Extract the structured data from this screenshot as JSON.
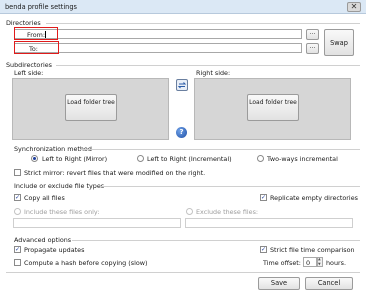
{
  "window": {
    "title": "benda profile settings",
    "close_glyph": "✕"
  },
  "directories": {
    "section_label": "Directories",
    "from_label": "From:",
    "from_value": "",
    "to_label": "To:",
    "to_value": "",
    "browse_label": "...",
    "swap_label": "Swap"
  },
  "subdirectories": {
    "section_label": "Subdirectories",
    "left_label": "Left side:",
    "right_label": "Right side:",
    "load_left_label": "Load folder tree",
    "load_right_label": "Load folder tree",
    "help_glyph": "?"
  },
  "sync": {
    "section_label": "Synchronization method",
    "options": [
      {
        "label": "Left to Right (Mirror)",
        "selected": true
      },
      {
        "label": "Left to Right (Incremental)",
        "selected": false
      },
      {
        "label": "Two-ways incremental",
        "selected": false
      }
    ],
    "strict_mirror_label": "Strict mirror: revert files that were modified on the right.",
    "strict_mirror_checked": false
  },
  "filters": {
    "section_label": "Include or exclude file types",
    "copy_all_label": "Copy all files",
    "copy_all_checked": true,
    "replicate_label": "Replicate empty directories",
    "replicate_checked": true,
    "include_label": "Include these files only:",
    "exclude_label": "Exclude these files:",
    "include_value": "",
    "exclude_value": ""
  },
  "advanced": {
    "section_label": "Advanced options",
    "propagate_label": "Propagate updates",
    "propagate_checked": true,
    "strict_time_label": "Strict file time comparison",
    "strict_time_checked": true,
    "hash_label": "Compute a hash before copying (slow)",
    "hash_checked": false,
    "time_offset_label": "Time offset:",
    "time_offset_value": "0",
    "hours_label": "hours."
  },
  "footer": {
    "save_label": "Save",
    "cancel_label": "Cancel"
  },
  "colors": {
    "highlight": "#e01b1b",
    "panel_bg": "#d6d6d6",
    "accent": "#1e3e9c"
  }
}
